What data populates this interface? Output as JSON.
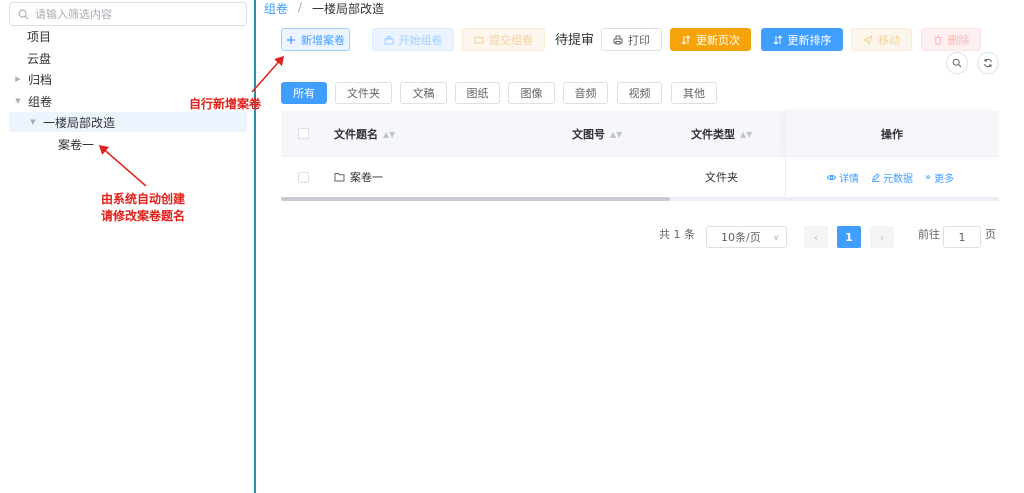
{
  "sidebar": {
    "search_placeholder": "请输入筛选内容",
    "tree": {
      "item_project": "项目",
      "item_cloud": "云盘",
      "item_archive": "归档",
      "item_group": "组卷",
      "item_subfolder": "一楼局部改造",
      "item_case": "案卷一"
    },
    "annotation_auto": "由系统自动创建\n请修改案卷题名"
  },
  "breadcrumb": {
    "root": "组卷",
    "sep": "/",
    "current": "一楼局部改造"
  },
  "annotation_new": "自行新增案卷",
  "toolbar": {
    "new_case": "新增案卷",
    "start_group": "开始组卷",
    "submit_group": "提交组卷",
    "pending_review": "待提审",
    "print": "打印",
    "update_page": "更新页次",
    "update_sort": "更新排序",
    "move": "移动",
    "delete": "删除"
  },
  "colors": {
    "primary": "#409eff",
    "primary_light": "#ecf5ff",
    "warning": "#f5a30a",
    "danger_light": "#fef0f0",
    "annotation_red": "#e0201a",
    "divider_teal": "#2a8fa8"
  },
  "filters": [
    "所有",
    "文件夹",
    "文稿",
    "图纸",
    "图像",
    "音频",
    "视频",
    "其他"
  ],
  "table": {
    "columns": {
      "title": "文件题名",
      "doc_no": "文图号",
      "file_type": "文件类型",
      "ops": "操作"
    },
    "rows": [
      {
        "title": "案卷一",
        "doc_no": "",
        "file_type": "文件夹"
      }
    ],
    "row_ops": {
      "detail": "详情",
      "metadata": "元数据",
      "more": "更多"
    }
  },
  "pagination": {
    "total_prefix": "共",
    "total_value": "1",
    "total_suffix": "条",
    "page_size": "10条/页",
    "current_page": "1",
    "goto_prefix": "前往",
    "goto_value": "1",
    "goto_suffix": "页"
  }
}
